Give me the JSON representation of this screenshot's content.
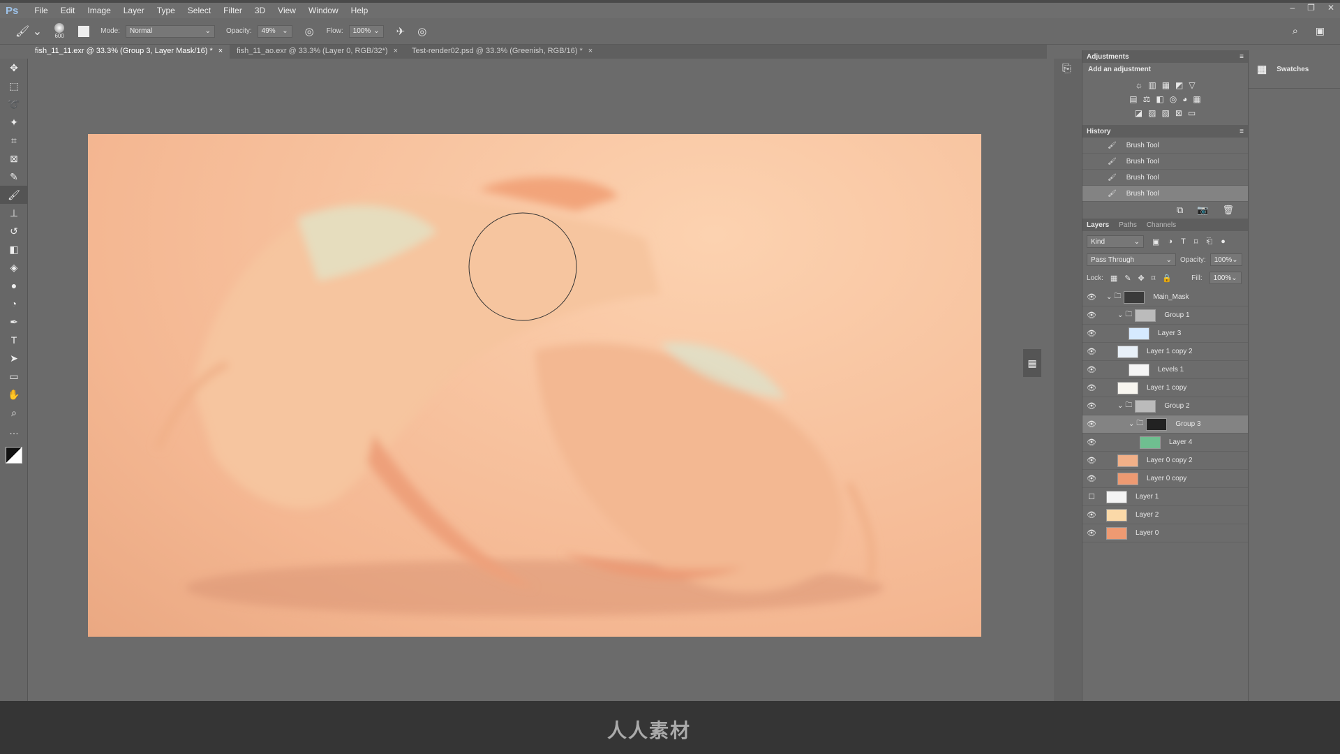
{
  "app": {
    "logo": "Ps"
  },
  "menu": [
    "File",
    "Edit",
    "Image",
    "Layer",
    "Type",
    "Select",
    "Filter",
    "3D",
    "View",
    "Window",
    "Help"
  ],
  "window_controls": [
    "–",
    "❐",
    "✕"
  ],
  "options": {
    "brush_size": "600",
    "mode_label": "Mode:",
    "mode": "Normal",
    "opacity_label": "Opacity:",
    "opacity": "49%",
    "flow_label": "Flow:",
    "flow": "100%"
  },
  "tabs": [
    {
      "label": "fish_11_11.exr @ 33.3% (Group 3, Layer Mask/16) *",
      "close": "×"
    },
    {
      "label": "fish_11_ao.exr @ 33.3% (Layer 0, RGB/32*)",
      "close": "×"
    },
    {
      "label": "Test-render02.psd @ 33.3% (Greenish, RGB/16) *",
      "close": "×"
    }
  ],
  "tools": [
    {
      "icon": "move-icon",
      "g": "✥"
    },
    {
      "icon": "marquee-icon",
      "g": "⬚"
    },
    {
      "icon": "lasso-icon",
      "g": "➰"
    },
    {
      "icon": "magic-wand-icon",
      "g": "✦"
    },
    {
      "icon": "crop-icon",
      "g": "⌗"
    },
    {
      "icon": "frame-icon",
      "g": "⊠"
    },
    {
      "icon": "eyedropper-icon",
      "g": "✎"
    },
    {
      "icon": "brush-icon",
      "g": "🖌"
    },
    {
      "icon": "stamp-icon",
      "g": "⊥"
    },
    {
      "icon": "history-brush-icon",
      "g": "↺"
    },
    {
      "icon": "eraser-icon",
      "g": "◧"
    },
    {
      "icon": "paint-bucket-icon",
      "g": "◈"
    },
    {
      "icon": "blur-icon",
      "g": "●"
    },
    {
      "icon": "dodge-icon",
      "g": "◔"
    },
    {
      "icon": "pen-icon",
      "g": "✒"
    },
    {
      "icon": "type-icon",
      "g": "T"
    },
    {
      "icon": "path-select-icon",
      "g": "➤"
    },
    {
      "icon": "rectangle-icon",
      "g": "▭"
    },
    {
      "icon": "hand-icon",
      "g": "✋"
    },
    {
      "icon": "zoom-icon",
      "g": "⌕"
    },
    {
      "icon": "more-icon",
      "g": "…"
    }
  ],
  "adjustments": {
    "title": "Adjustments",
    "subtitle": "Add an adjustment",
    "rows": [
      [
        "☼",
        "▥",
        "▦",
        "◩",
        "▽"
      ],
      [
        "▤",
        "⚖",
        "◧",
        "◎",
        "◕",
        "▦"
      ],
      [
        "◪",
        "▨",
        "▧",
        "⊠",
        "▭"
      ]
    ]
  },
  "history": {
    "title": "History",
    "items": [
      "Brush Tool",
      "Brush Tool",
      "Brush Tool",
      "Brush Tool"
    ]
  },
  "layers": {
    "tabs": [
      "Layers",
      "Paths",
      "Channels"
    ],
    "kind": "Kind",
    "blend": "Pass Through",
    "opacity_label": "Opacity:",
    "opacity": "100%",
    "lock_label": "Lock:",
    "fill_label": "Fill:",
    "fill": "100%",
    "items": [
      {
        "name": "Main_Mask",
        "indent": 0,
        "group": true,
        "visible": true,
        "thumb": "#3a3a3a"
      },
      {
        "name": "Group 1",
        "indent": 1,
        "group": true,
        "visible": true,
        "thumb": "#bbbbbb"
      },
      {
        "name": "Layer 3",
        "indent": 2,
        "visible": true,
        "thumb": "#d6eaff"
      },
      {
        "name": "Layer 1 copy 2",
        "indent": 1,
        "visible": true,
        "thumb": "#e8f0f8"
      },
      {
        "name": "Levels 1",
        "indent": 2,
        "visible": true,
        "thumb": "#f5f5f5"
      },
      {
        "name": "Layer 1 copy",
        "indent": 1,
        "visible": true,
        "thumb": "#f8f6f0"
      },
      {
        "name": "Group 2",
        "indent": 1,
        "group": true,
        "visible": true,
        "thumb": "#bbbbbb"
      },
      {
        "name": "Group 3",
        "indent": 2,
        "group": true,
        "visible": true,
        "selected": true,
        "thumb": "#222222"
      },
      {
        "name": "Layer 4",
        "indent": 3,
        "visible": true,
        "thumb": "#6fbf90"
      },
      {
        "name": "Layer 0 copy 2",
        "indent": 1,
        "visible": true,
        "thumb": "#f2b088"
      },
      {
        "name": "Layer 0 copy",
        "indent": 1,
        "visible": true,
        "thumb": "#ee9a72"
      },
      {
        "name": "Layer 1",
        "indent": 0,
        "visible": false,
        "thumb": "#f4f4f4"
      },
      {
        "name": "Layer 2",
        "indent": 0,
        "visible": true,
        "thumb": "#fbd9a8"
      },
      {
        "name": "Layer 0",
        "indent": 0,
        "visible": true,
        "thumb": "#ee9a72"
      }
    ]
  },
  "swatches": {
    "title": "Swatches"
  },
  "watermark": {
    "text": "人人素材"
  }
}
